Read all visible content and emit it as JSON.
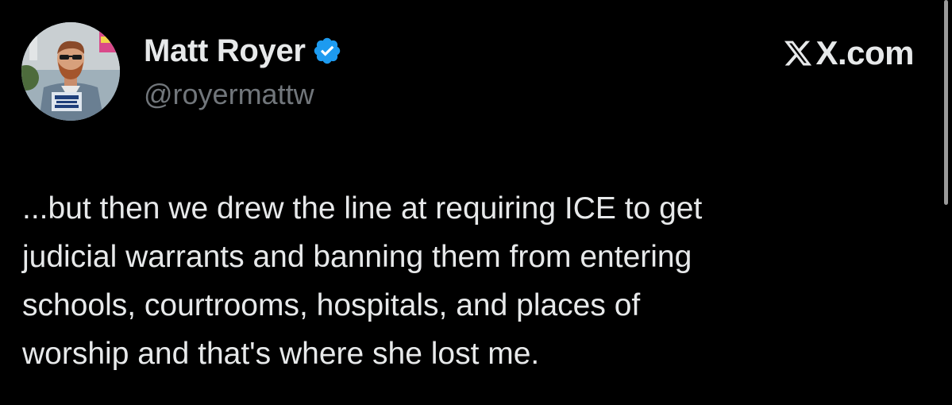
{
  "author": {
    "display_name": "Matt Royer",
    "handle": "@royermattw",
    "verified": true,
    "verified_color": "#1d9bf0",
    "avatar_icon": "profile-photo"
  },
  "brand": {
    "label": "X.com",
    "icon": "x-logo-icon"
  },
  "tweet": {
    "text": "...but then we drew the line at requiring ICE to get\njudicial warrants and banning them from entering\nschools, courtrooms, hospitals, and places of\nworship and that's where she lost me."
  },
  "colors": {
    "background": "#000000",
    "primary_text": "#e7e9ea",
    "secondary_text": "#71767b"
  }
}
